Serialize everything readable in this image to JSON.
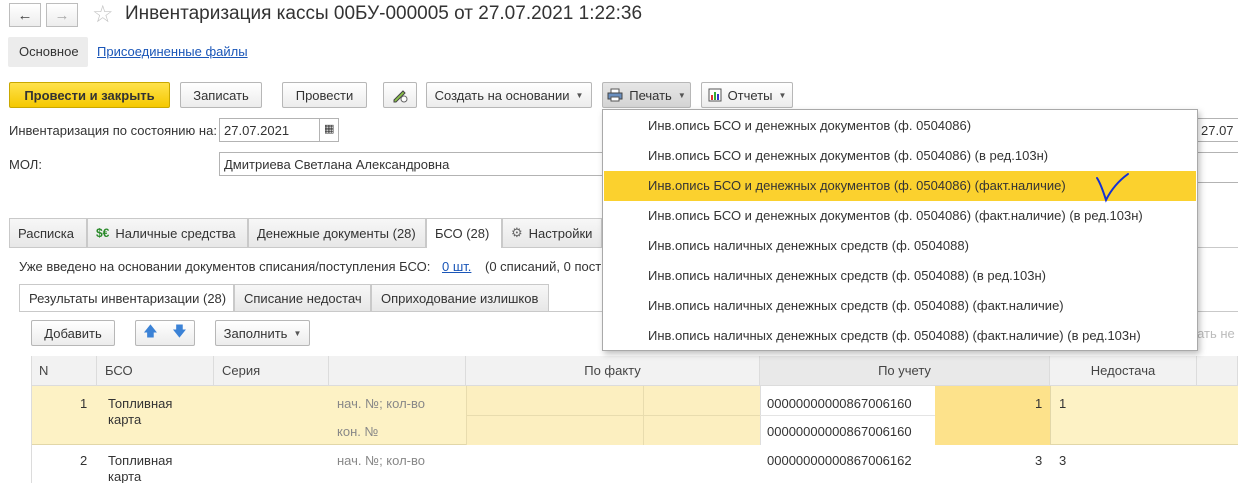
{
  "window": {
    "title": "Инвентаризация кассы 00БУ-000005 от 27.07.2021 1:22:36",
    "back_icon": "←",
    "forward_icon": "→",
    "star_icon": "☆"
  },
  "nav_tabs": {
    "main": "Основное",
    "files": "Присоединенные файлы"
  },
  "toolbar": {
    "post_close": "Провести и закрыть",
    "save": "Записать",
    "post": "Провести",
    "create_based": "Создать на основании",
    "print": "Печать",
    "reports": "Отчеты"
  },
  "fields": {
    "inv_date_label": "Инвентаризация по состоянию на:",
    "inv_date_value": "27.07.2021",
    "mol_label": "МОЛ:",
    "mol_value": "Дмитриева Светлана Александровна",
    "right_date_partial": "27.07"
  },
  "tabs": [
    {
      "label": "Расписка"
    },
    {
      "label": "Наличные средства"
    },
    {
      "label": "Денежные документы (28)"
    },
    {
      "label": "БСО (28)"
    },
    {
      "label": "Настройки"
    }
  ],
  "info": {
    "text": "Уже введено на основании документов списания/поступления БСО:",
    "link": "0 шт.",
    "rest": "(0 списаний, 0 пост"
  },
  "subtabs": [
    {
      "label": "Результаты инвентаризации (28)"
    },
    {
      "label": "Списание недостач"
    },
    {
      "label": "Оприходование излишков"
    }
  ],
  "table_toolbar": {
    "add": "Добавить",
    "fill": "Заполнить",
    "partial_right": "итать не"
  },
  "table": {
    "headers": {
      "n": "N",
      "bso": "БСО",
      "series": "Серия",
      "fact": "По факту",
      "account": "По учету",
      "shortage": "Недостача"
    },
    "rows": [
      {
        "n": "1",
        "bso_line1": "Топливная",
        "bso_line2": "карта",
        "label1": "нач. №; кол-во",
        "label2": "кон. №",
        "acc_start": "00000000000867006160",
        "acc_qty": "1",
        "acc_end": "00000000000867006160",
        "shortage": "1"
      },
      {
        "n": "2",
        "bso_line1": "Топливная",
        "bso_line2": "карта",
        "label1": "нач. №; кол-во",
        "acc_start": "00000000000867006162",
        "acc_qty": "3",
        "shortage": "3"
      }
    ]
  },
  "print_menu": {
    "items": [
      "Инв.опись БСО и денежных документов (ф. 0504086)",
      "Инв.опись БСО и денежных документов (ф. 0504086) (в ред.103н)",
      "Инв.опись БСО и денежных документов (ф. 0504086) (факт.наличие)",
      "Инв.опись БСО и денежных документов (ф. 0504086) (факт.наличие) (в ред.103н)",
      "Инв.опись наличных денежных средств (ф. 0504088)",
      "Инв.опись наличных денежных средств (ф. 0504088) (в ред.103н)",
      "Инв.опись наличных денежных средств (ф. 0504088) (факт.наличие)",
      "Инв.опись наличных денежных средств (ф. 0504088) (факт.наличие) (в ред.103н)"
    ],
    "selected_index": 2
  },
  "colors": {
    "accent_yellow": "#f5c800",
    "menu_selected": "#fbd12e",
    "row_highlight": "#fdf2c5",
    "link_blue": "#1a56b8",
    "annotation_blue": "#1330d6"
  }
}
